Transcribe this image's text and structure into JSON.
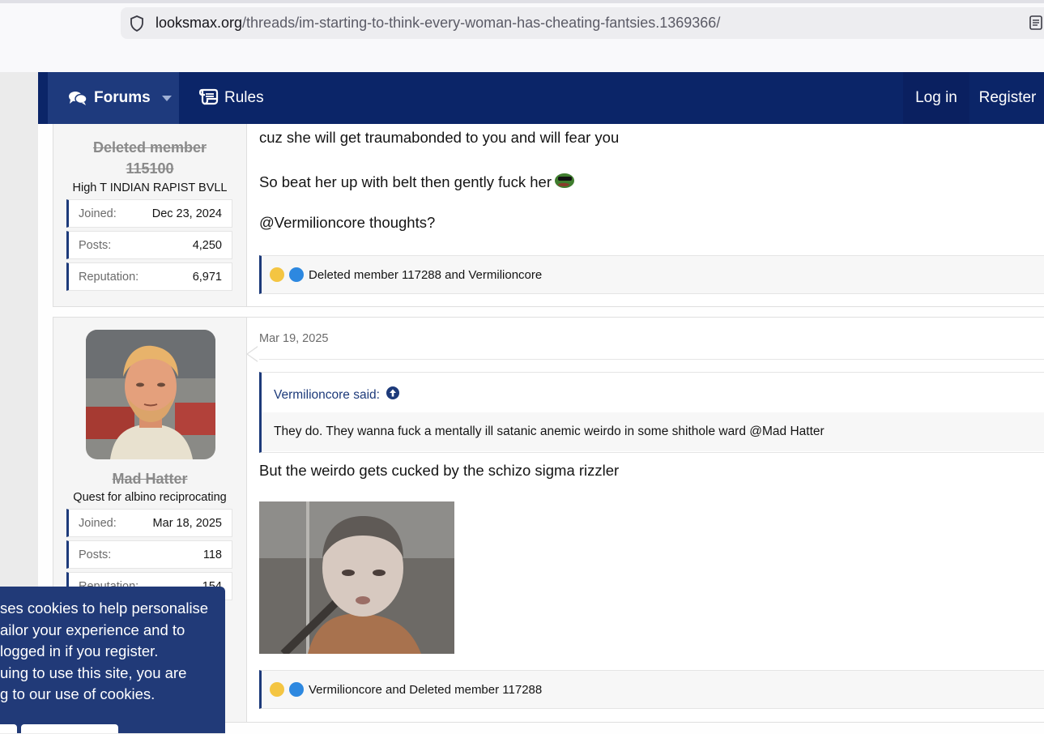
{
  "browser": {
    "url_domain": "looksmax.org",
    "url_path": "/threads/im-starting-to-think-every-woman-has-cheating-fantsies.1369366/"
  },
  "nav": {
    "forums_label": "Forums",
    "rules_label": "Rules",
    "login_label": "Log in",
    "register_label": "Register"
  },
  "post1": {
    "author": "Deleted member 115100",
    "author_line1": "Deleted member",
    "author_line2": "115100",
    "user_title": "High T INDIAN RAPIST BVLL",
    "stats": [
      {
        "label": "Joined:",
        "value": "Dec 23, 2024"
      },
      {
        "label": "Posts:",
        "value": "4,250"
      },
      {
        "label": "Reputation:",
        "value": "6,971"
      }
    ],
    "lines": [
      "cuz she will get traumabonded to you and will fear you",
      "So beat her up with belt then gently fuck her",
      "@Vermilioncore thoughts?"
    ],
    "reactions": "Deleted member 117288 and Vermilioncore"
  },
  "post2": {
    "author": "Mad Hatter",
    "user_title": "Quest for albino reciprocating",
    "stats": [
      {
        "label": "Joined:",
        "value": "Mar 18, 2025"
      },
      {
        "label": "Posts:",
        "value": "118"
      },
      {
        "label": "Reputation:",
        "value": "154"
      }
    ],
    "date": "Mar 19, 2025",
    "quote_author": "Vermilioncore said:",
    "quote_text": "They do. They wanna fuck a mentally ill satanic anemic weirdo in some shithole ward @Mad Hatter",
    "body": "But the weirdo gets cucked by the schizo sigma rizzler",
    "reactions": "Vermilioncore and Deleted member 117288"
  },
  "cookie_notice": {
    "lines": [
      "ses cookies to help personalise",
      "ailor your experience and to",
      "logged in if you register.",
      "uing to use this site, you are",
      "g to our use of cookies."
    ]
  },
  "colors": {
    "navbar": "#0b2568",
    "accent": "#1d3a7a",
    "cookie_bg": "#213a78"
  }
}
